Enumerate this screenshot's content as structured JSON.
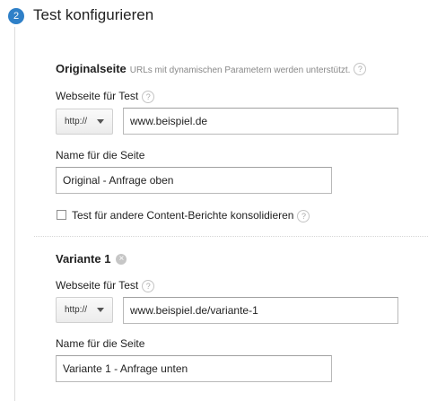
{
  "step": {
    "number": "2",
    "title": "Test konfigurieren"
  },
  "original": {
    "heading": "Originalseite",
    "hint": "URLs mit dynamischen Parametern werden unterstützt.",
    "help_icon": "?",
    "url_label": "Webseite für Test",
    "protocol": "http://",
    "url_value": "www.beispiel.de",
    "name_label": "Name für die Seite",
    "name_value": "Original - Anfrage oben",
    "consolidate_label": "Test für andere Content-Berichte konsolidieren",
    "consolidate_checked": false
  },
  "variant": {
    "heading": "Variante 1",
    "remove_icon": "×",
    "help_icon": "?",
    "url_label": "Webseite für Test",
    "protocol": "http://",
    "url_value": "www.beispiel.de/variante-1",
    "name_label": "Name für die Seite",
    "name_value": "Variante 1 - Anfrage unten"
  },
  "colors": {
    "accent": "#2f80c8",
    "border": "#b9b9b9"
  }
}
